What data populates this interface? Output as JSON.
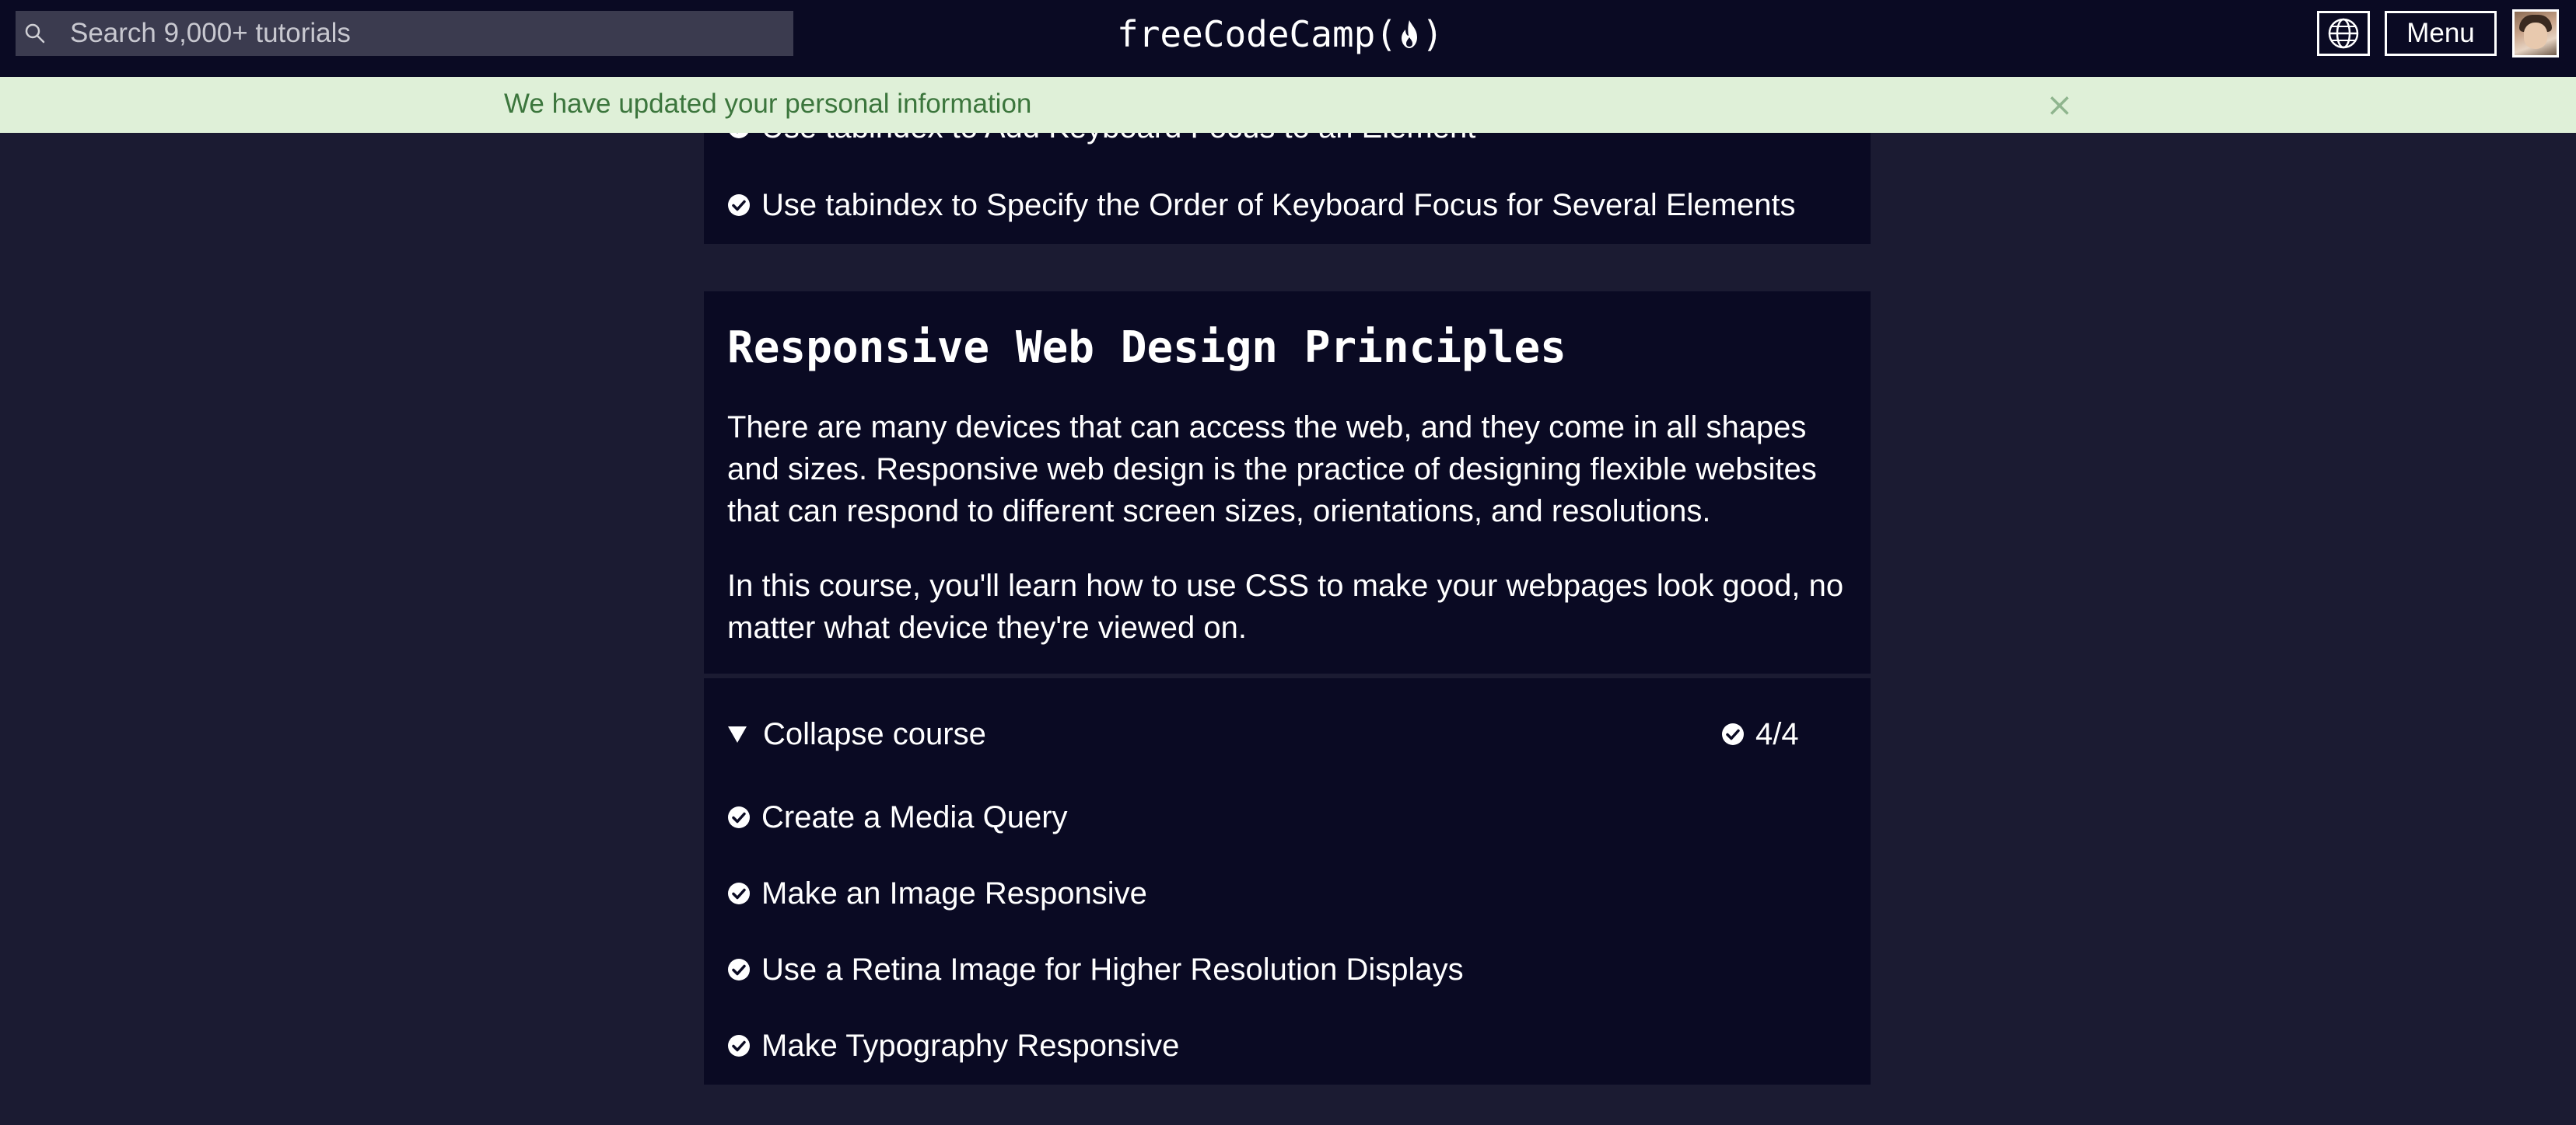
{
  "header": {
    "search_placeholder": "Search 9,000+ tutorials",
    "logo_text_left": "freeCodeCamp(",
    "logo_text_right": ")",
    "menu_label": "Menu"
  },
  "flash": {
    "message": "We have updated your personal information",
    "close_glyph": "×"
  },
  "previous_block": {
    "challenges": [
      "Use tabindex to Add Keyboard Focus to an Element",
      "Use tabindex to Specify the Order of Keyboard Focus for Several Elements"
    ]
  },
  "block": {
    "title": "Responsive Web Design Principles",
    "paragraphs": [
      "There are many devices that can access the web, and they come in all shapes and sizes. Responsive web design is the practice of designing flexible websites that can respond to different screen sizes, orientations, and resolutions.",
      "In this course, you'll learn how to use CSS to make your webpages look good, no matter what device they're viewed on."
    ],
    "collapse_label": "Collapse course",
    "progress": "4/4",
    "challenges": [
      "Create a Media Query",
      "Make an Image Responsive",
      "Use a Retina Image for Higher Resolution Displays",
      "Make Typography Responsive"
    ]
  },
  "icons": {
    "search": "search-icon",
    "flame": "flame-icon",
    "globe": "globe-icon",
    "close": "close-icon",
    "check": "check-circle-icon",
    "caret": "caret-down-icon"
  },
  "colors": {
    "page_bg": "#1b1b32",
    "nav_bg": "#0a0a23",
    "search_bg": "#3b3b4f",
    "flash_bg": "#dff0d8",
    "flash_text": "#3c763d",
    "text": "#ffffff"
  }
}
